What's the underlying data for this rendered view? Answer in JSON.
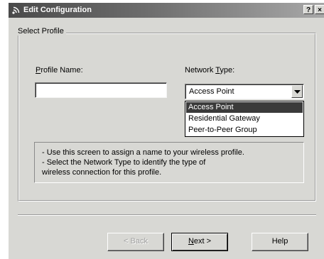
{
  "window": {
    "title": "Edit Configuration",
    "help_button": "?",
    "close_button": "×"
  },
  "form": {
    "group_label": "Select Profile",
    "profile_name_label_pre": "",
    "profile_name_label_key": "P",
    "profile_name_label_post": "rofile Name:",
    "profile_name_value": "",
    "network_type_label_pre": "Network ",
    "network_type_label_key": "T",
    "network_type_label_post": "ype:",
    "network_type_selected": "Access Point",
    "network_type_options": [
      "Access Point",
      "Residential Gateway",
      "Peer-to-Peer Group"
    ],
    "highlighted_option_index": 0
  },
  "info": {
    "lines": [
      "- Use this screen to assign a name to your wireless profile.",
      "- Select the Network Type to identify the type of",
      "  wireless connection for this profile."
    ]
  },
  "buttons": {
    "back_label": "< Back",
    "next_pre": "",
    "next_key": "N",
    "next_post": "ext >",
    "help_label": "Help"
  },
  "colors": {
    "dialog_bg": "#d8d8d4",
    "selection_bg": "#3a3a3a",
    "title_gradient_start": "#4a4a4a"
  }
}
